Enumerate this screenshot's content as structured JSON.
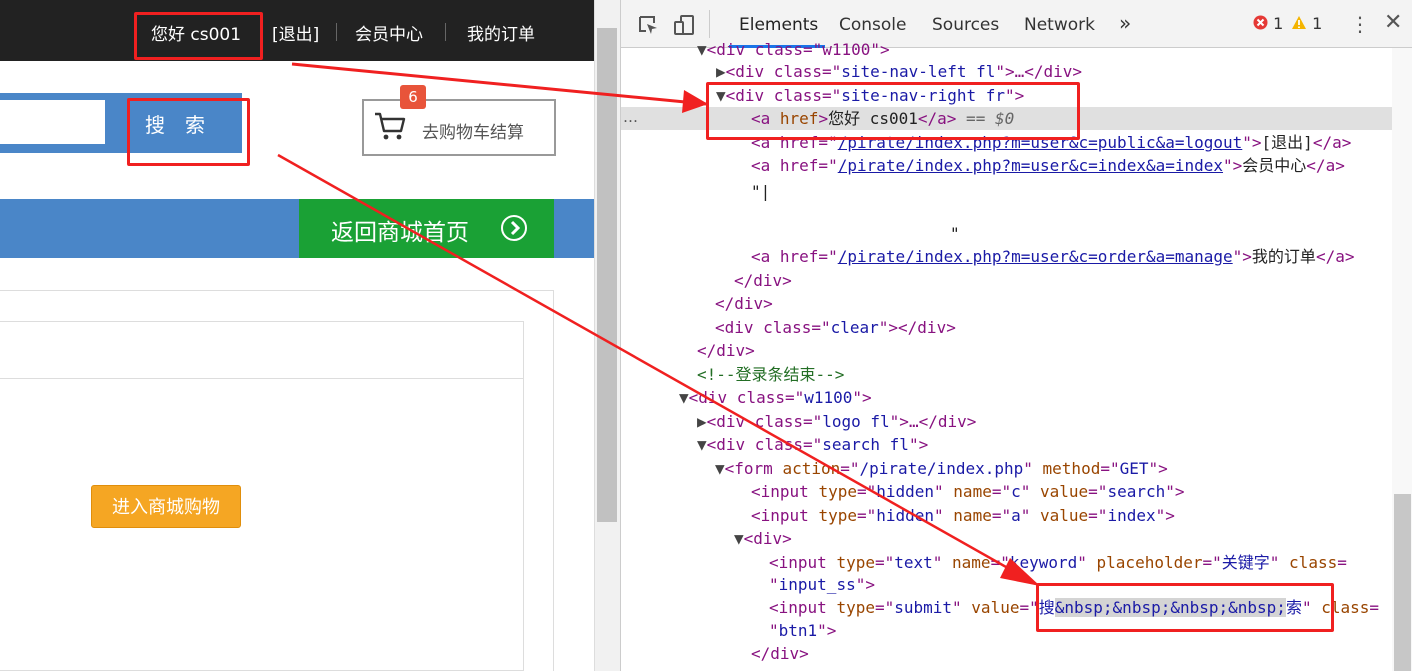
{
  "webpage": {
    "nav": {
      "greeting": "您好 cs001",
      "logout": "[退出]",
      "member_center": "会员中心",
      "my_orders": "我的订单"
    },
    "search": {
      "button_label": "搜　索",
      "input_value": ""
    },
    "cart": {
      "label": "去购物车结算",
      "count": "6"
    },
    "home_button": {
      "label": "返回商城首页"
    },
    "enter_button": {
      "label": "进入商城购物"
    }
  },
  "devtools": {
    "tabs": [
      "Elements",
      "Console",
      "Sources",
      "Network"
    ],
    "more_tabs": "»",
    "active_tab": "Elements",
    "errors": "1",
    "warnings": "1",
    "selected_suffix": " == $0",
    "lines": {
      "l0_tag": "<div class=\"w1100\">",
      "l1_a": "<div class=\"",
      "l1_v": "site-nav-left fl",
      "l1_b": "\">…</div>",
      "l2_a": "<div class=\"",
      "l2_v": "site-nav-right fr",
      "l2_b": "\">",
      "l3_a": "<a ",
      "l3_attr": "href",
      "l3_b": ">",
      "l3_text": "您好 cs001",
      "l3_c": "</a>",
      "l4_a": "<a href=\"",
      "l4_href": "/pirate/index.php?m=user&c=public&a=logout",
      "l4_b": "\">",
      "l4_text": "[退出]",
      "l4_c": "</a>",
      "l5_href": "/pirate/index.php?m=user&c=index&a=index",
      "l5_text": "会员中心",
      "l6": "\"|",
      "l7": "\"",
      "l8_href": "/pirate/index.php?m=user&c=order&a=manage",
      "l8_text": "我的订单",
      "l9": "</div>",
      "l10": "</div>",
      "l11_a": "<div class=\"",
      "l11_v": "clear",
      "l11_b": "\"></div>",
      "l12": "</div>",
      "l13": "<!--登录条结束-->",
      "l14_v": "w1100",
      "l15_v": "logo fl",
      "l16_v": "search fl",
      "l17_action": "/pirate/index.php",
      "l17_method": "GET",
      "l18_value": "search",
      "l19_value": "index",
      "l20": "<div>",
      "l21_type": "text",
      "l21_name": "keyword",
      "l21_ph": "关键字",
      "l22_class": "input_ss",
      "l23_type": "submit",
      "l23_v1": "搜",
      "l23_nbsp": "&nbsp;&nbsp;&nbsp;&nbsp;",
      "l23_v2": "索",
      "l24_class": "btn1",
      "l25": "</div>"
    }
  },
  "colors": {
    "annotation_red": "#f02020",
    "home_green": "#1aa135",
    "nav_blue": "#4a86c8",
    "cart_badge": "#e8543a",
    "enter_orange": "#f5a623"
  }
}
